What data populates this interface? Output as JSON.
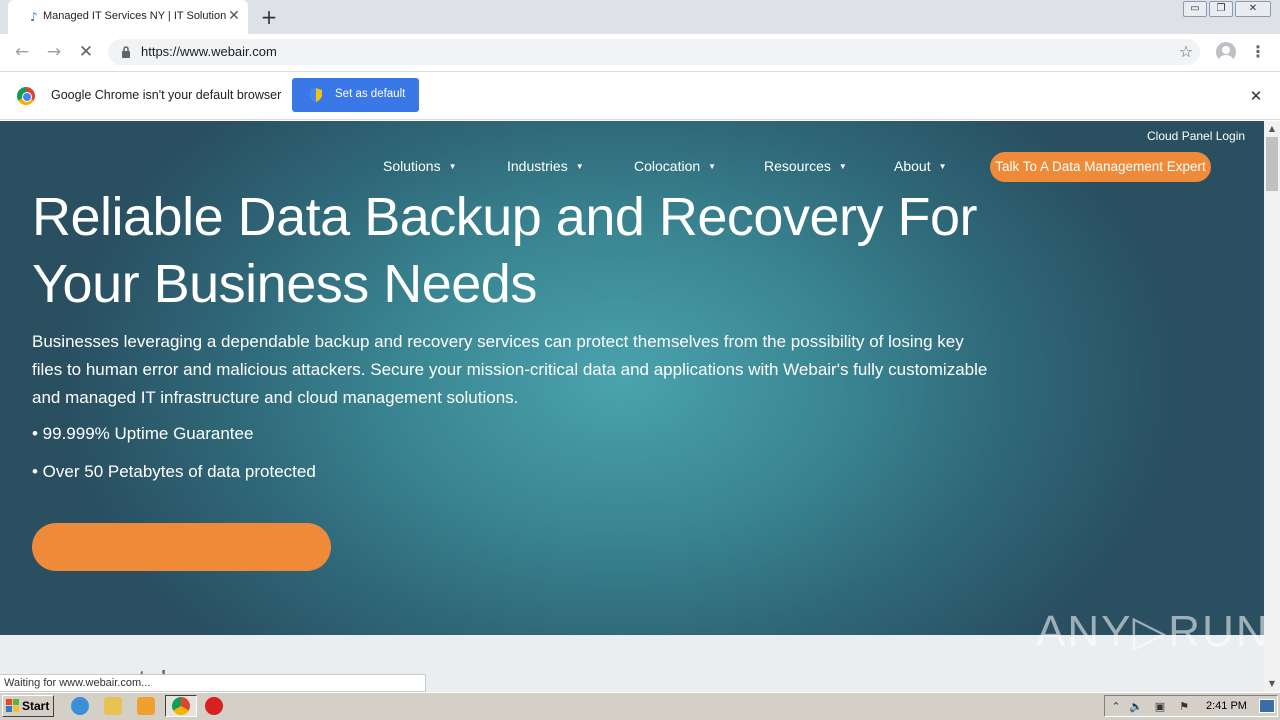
{
  "browser": {
    "tab_title": "Managed IT Services NY | IT Solution",
    "tab_close": "✕",
    "new_tab": "+",
    "url": "https://www.webair.com",
    "window_buttons": [
      "▭",
      "❐",
      "✕"
    ]
  },
  "infobar": {
    "message": "Google Chrome isn't your default browser",
    "button_label": "Set as default",
    "close": "✕"
  },
  "site": {
    "cloud_login": "Cloud Panel Login",
    "nav": [
      {
        "label": "Solutions",
        "caret": "▼"
      },
      {
        "label": "Industries",
        "caret": "▼"
      },
      {
        "label": "Colocation",
        "caret": "▼"
      },
      {
        "label": "Resources",
        "caret": "▼"
      },
      {
        "label": "About",
        "caret": "▼"
      }
    ],
    "nav_cta": "Talk To A Data Management Expert",
    "headline": "Reliable Data Backup and Recovery For Your Business Needs",
    "intro": "Businesses leveraging a dependable backup and recovery services can protect themselves from the possibility of losing key files to human error and malicious attackers. Secure your mission-critical data and applications with Webair's fully customizable and managed IT infrastructure and cloud management solutions.",
    "bullets": [
      "• 99.999% Uptime Guarantee",
      "• Over 50 Petabytes of data protected"
    ],
    "below_heading": "...............ta!"
  },
  "status_bar": "Waiting for www.webair.com...",
  "watermark": "ANY▷RUN",
  "taskbar": {
    "start_label": "Start",
    "clock": "2:41 PM"
  },
  "colors": {
    "accent_orange": "#ee8a38",
    "hero_teal": "#3a8592",
    "chrome_blue": "#3b78e7"
  }
}
